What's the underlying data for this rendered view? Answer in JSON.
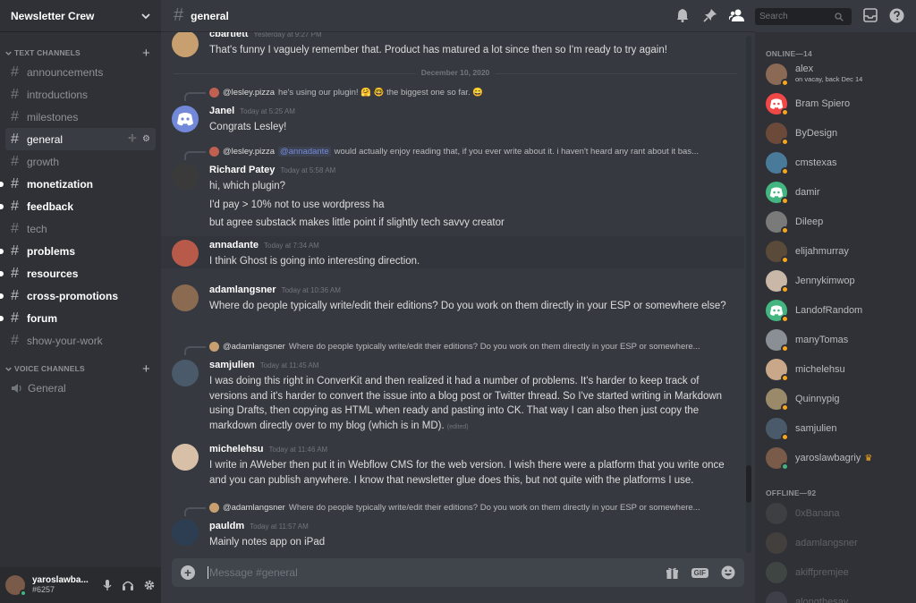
{
  "server": {
    "name": "Newsletter Crew"
  },
  "sidebar": {
    "text_category": "TEXT CHANNELS",
    "voice_category": "VOICE CHANNELS",
    "channels": [
      {
        "name": "announcements",
        "state": "normal"
      },
      {
        "name": "introductions",
        "state": "normal"
      },
      {
        "name": "milestones",
        "state": "normal"
      },
      {
        "name": "general",
        "state": "active"
      },
      {
        "name": "growth",
        "state": "normal"
      },
      {
        "name": "monetization",
        "state": "unread"
      },
      {
        "name": "feedback",
        "state": "unread"
      },
      {
        "name": "tech",
        "state": "normal"
      },
      {
        "name": "problems",
        "state": "unread"
      },
      {
        "name": "resources",
        "state": "unread"
      },
      {
        "name": "cross-promotions",
        "state": "unread"
      },
      {
        "name": "forum",
        "state": "unread"
      },
      {
        "name": "show-your-work",
        "state": "normal"
      }
    ],
    "voice_channels": [
      {
        "name": "General"
      }
    ]
  },
  "user_panel": {
    "name": "yaroslawba...",
    "tag": "#6257"
  },
  "chat": {
    "channel": "general",
    "search_placeholder": "Search",
    "composer_placeholder": "Message #general",
    "date_divider": "December 10, 2020",
    "messages": [
      {
        "author": "cbartlett",
        "time": "Yesterday at 9:27 PM",
        "lines": [
          "That's funny I vaguely remember that. Product has matured a lot since then so I'm ready to try again!"
        ]
      },
      {
        "reply": {
          "name": "@lesley.pizza",
          "text": "he's using our plugin! 🤗 🤓 the biggest one so far. 😄"
        },
        "author": "Janel",
        "time": "Today at 5:25 AM",
        "lines": [
          "Congrats Lesley!"
        ]
      },
      {
        "reply": {
          "name": "@lesley.pizza",
          "mention": "@annadante",
          "text": "would actually enjoy reading that, if you ever write about it. i haven't heard any rant about it bas..."
        },
        "author": "Richard Patey",
        "time": "Today at 5:58 AM",
        "lines": [
          "hi, which plugin?",
          "I'd pay > 10% not to use wordpress ha",
          "but agree substack makes little point if slightly tech savvy creator"
        ]
      },
      {
        "author": "annadante",
        "time": "Today at 7:34 AM",
        "lines": [
          "I think Ghost is going into interesting direction."
        ]
      },
      {
        "author": "adamlangsner",
        "time": "Today at 10:36 AM",
        "lines": [
          "Where do people typically write/edit their editions? Do you work on them directly in your ESP or somewhere else?"
        ]
      },
      {
        "reply": {
          "name": "@adamlangsner",
          "text": "Where do people typically write/edit their editions? Do you work on them directly in your ESP or somewhere..."
        },
        "author": "samjulien",
        "time": "Today at 11:45 AM",
        "lines": [
          "I was doing this right in ConverKit and then realized it had a number of problems. It's harder to keep track of versions and it's harder to convert the issue into a blog post or Twitter thread. So I've started writing in Markdown using Drafts, then copying as HTML when ready and pasting into CK. That way I can also then just copy the markdown directly over to my blog (which is in MD)."
        ],
        "edited": "(edited)"
      },
      {
        "author": "michelehsu",
        "time": "Today at 11:46 AM",
        "lines": [
          "I write in AWeber then put it in Webflow CMS for the web version. I wish there were a platform that you write once and you can publish anywhere. I know that newsletter glue does this, but not quite with the platforms I use."
        ]
      },
      {
        "reply": {
          "name": "@adamlangsner",
          "text": "Where do people typically write/edit their editions? Do you work on them directly in your ESP or somewhere..."
        },
        "author": "pauldm",
        "time": "Today at 11:57 AM",
        "lines": [
          "Mainly notes app on iPad"
        ]
      }
    ]
  },
  "members": {
    "online_label": "ONLINE—14",
    "offline_label": "OFFLINE—92",
    "online": [
      {
        "name": "alex",
        "sub": "on vacay, back Dec 14",
        "color": "#8a6a55"
      },
      {
        "name": "Bram Spiero",
        "color": "#f04747"
      },
      {
        "name": "ByDesign",
        "color": "#6b4a3a"
      },
      {
        "name": "cmstexas",
        "color": "#4a7a9a"
      },
      {
        "name": "damir",
        "color": "#43b581"
      },
      {
        "name": "Dileep",
        "color": "#7a7a7a"
      },
      {
        "name": "elijahmurray",
        "color": "#5a4a3a"
      },
      {
        "name": "Jennykimwop",
        "color": "#c9b8a8"
      },
      {
        "name": "LandofRandom",
        "color": "#43b581"
      },
      {
        "name": "manyTomas",
        "color": "#8a8f96"
      },
      {
        "name": "michelehsu",
        "color": "#c9a88a"
      },
      {
        "name": "Quinnypig",
        "color": "#9a8a6a"
      },
      {
        "name": "samjulien",
        "color": "#4a5a6a"
      },
      {
        "name": "yaroslawbagriy",
        "color": "#7a5a48",
        "online": true
      }
    ],
    "offline": [
      {
        "name": "0xBanana",
        "color": "#5a5a5a"
      },
      {
        "name": "adamlangsner",
        "color": "#6a5a4a"
      },
      {
        "name": "akiffpremjee",
        "color": "#5a6a5a"
      },
      {
        "name": "alongthesay",
        "color": "#5a5a6a"
      }
    ]
  }
}
